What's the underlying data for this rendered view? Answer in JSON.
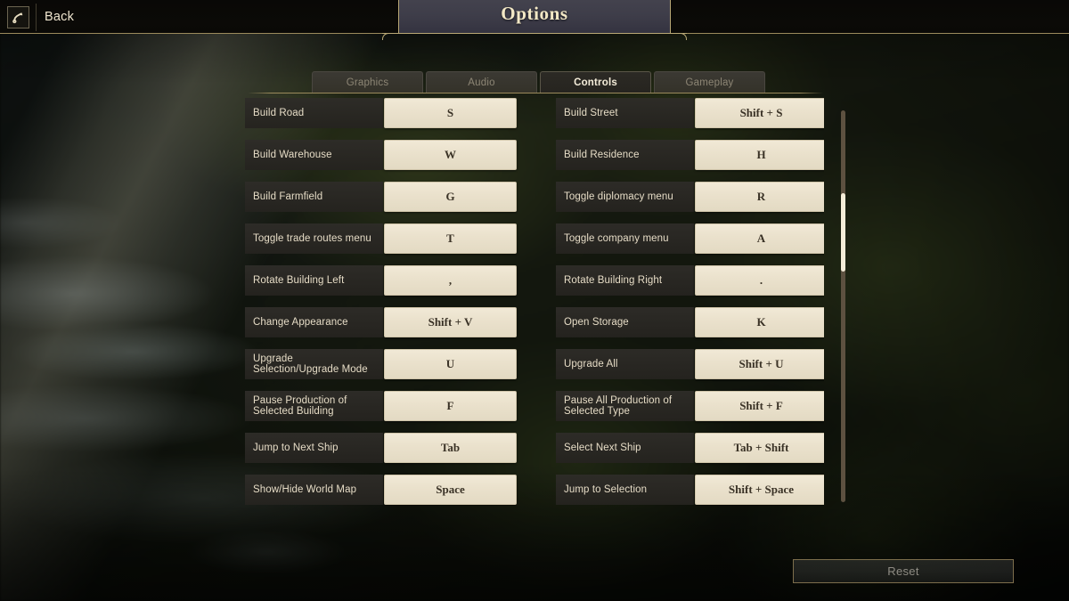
{
  "topbar": {
    "back_label": "Back",
    "back_icon": "back-arrow-icon"
  },
  "title": "Options",
  "tabs": [
    {
      "label": "Graphics",
      "active": false
    },
    {
      "label": "Audio",
      "active": false
    },
    {
      "label": "Controls",
      "active": true
    },
    {
      "label": "Gameplay",
      "active": false
    }
  ],
  "bindings": {
    "left": [
      {
        "action": "Build Road",
        "key": "S"
      },
      {
        "action": "Build Warehouse",
        "key": "W"
      },
      {
        "action": "Build Farmfield",
        "key": "G"
      },
      {
        "action": "Toggle trade routes menu",
        "key": "T"
      },
      {
        "action": "Rotate Building Left",
        "key": ","
      },
      {
        "action": "Change Appearance",
        "key": "Shift + V"
      },
      {
        "action": "Upgrade Selection/Upgrade Mode",
        "key": "U"
      },
      {
        "action": "Pause Production of Selected Building",
        "key": "F"
      },
      {
        "action": "Jump to Next Ship",
        "key": "Tab"
      },
      {
        "action": "Show/Hide World Map",
        "key": "Space"
      }
    ],
    "right": [
      {
        "action": "Build Street",
        "key": "Shift + S"
      },
      {
        "action": "Build Residence",
        "key": "H"
      },
      {
        "action": "Toggle diplomacy menu",
        "key": "R"
      },
      {
        "action": "Toggle company menu",
        "key": "A"
      },
      {
        "action": "Rotate Building Right",
        "key": "."
      },
      {
        "action": "Open Storage",
        "key": "K"
      },
      {
        "action": "Upgrade All",
        "key": "Shift + U"
      },
      {
        "action": "Pause All Production of Selected Type",
        "key": "Shift + F"
      },
      {
        "action": "Select Next Ship",
        "key": "Tab + Shift"
      },
      {
        "action": "Jump to Selection",
        "key": "Shift + Space"
      }
    ]
  },
  "reset_label": "Reset",
  "colors": {
    "gold_border": "#9b8a5c",
    "parchment": "#eae1cc",
    "key_text": "#3a3226",
    "label_text": "#e6dcc6",
    "tab_active_text": "#f4ecd9",
    "tab_inactive_text": "#8d8675",
    "scroll_thumb": "#f5edd8",
    "reset_text": "#8f8c84"
  }
}
